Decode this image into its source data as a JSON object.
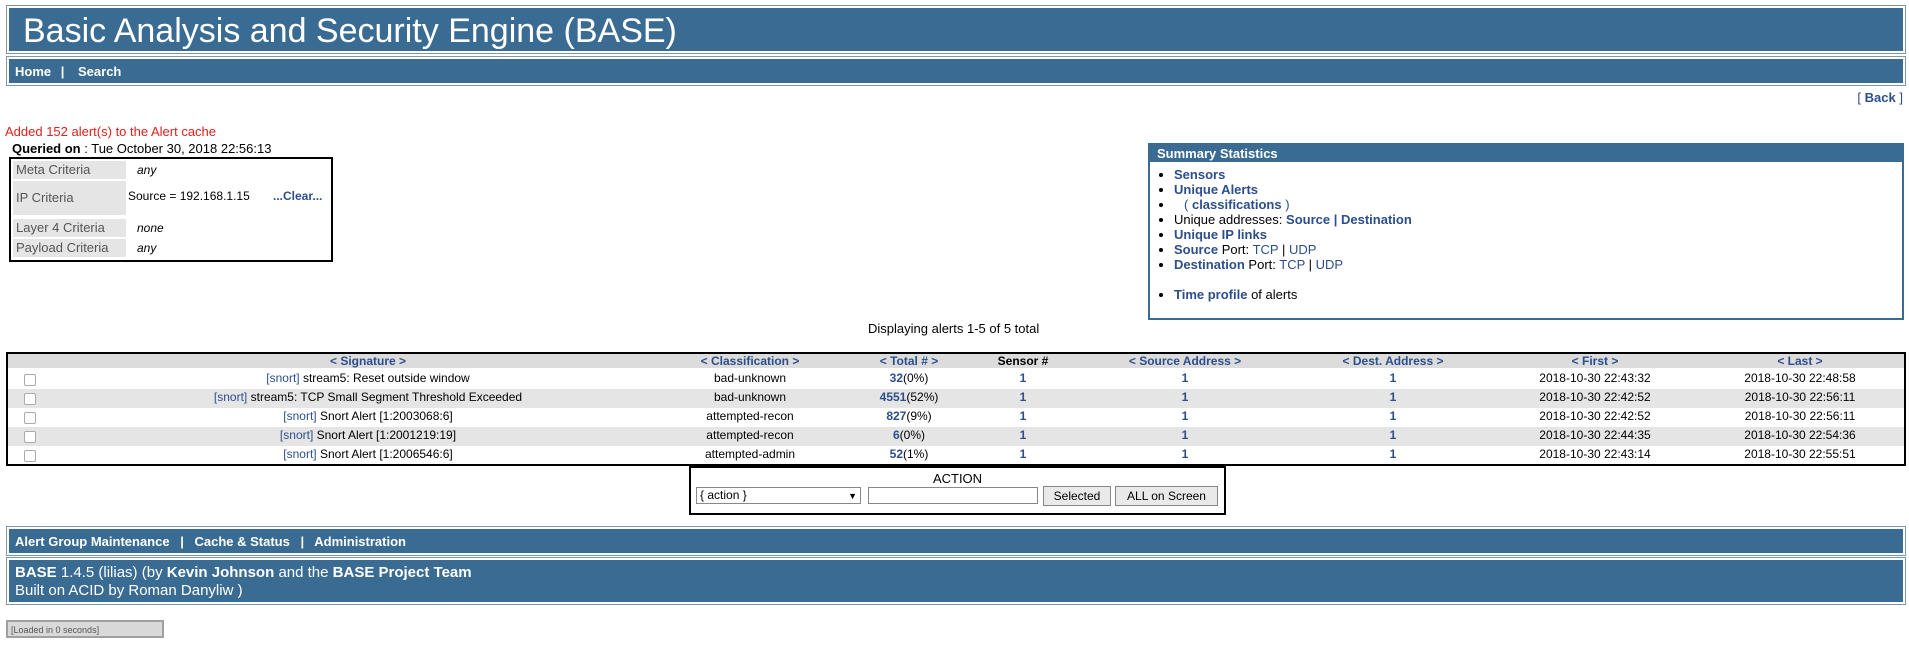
{
  "app": {
    "title": "Basic Analysis and Security Engine (BASE)"
  },
  "nav": {
    "home": "Home",
    "sep": "|",
    "search": "Search"
  },
  "back": {
    "open": "[",
    "label": "Back",
    "close": "]"
  },
  "cache_message": "Added 152 alert(s) to the Alert cache",
  "queried": {
    "label": "Queried on",
    "sep": " : ",
    "value": "Tue October 30, 2018 22:56:13"
  },
  "criteria": {
    "meta": {
      "label": "Meta Criteria",
      "value": "any"
    },
    "ip": {
      "label": "IP Criteria",
      "value": "Source = 192.168.1.15",
      "clear": "...Clear..."
    },
    "layer4": {
      "label": "Layer 4 Criteria",
      "value": "none"
    },
    "payload": {
      "label": "Payload Criteria",
      "value": "any"
    }
  },
  "summary": {
    "title": "Summary Statistics",
    "sensors": "Sensors",
    "unique_alerts": "Unique Alerts",
    "classifications": "classifications",
    "unique_addresses": "Unique addresses:",
    "source": "Source",
    "destination": "Destination",
    "unique_ip_links": "Unique IP links",
    "source_port_label": "Source",
    "port": "Port:",
    "tcp": "TCP",
    "udp": "UDP",
    "dest_port_label": "Destination",
    "time_profile": "Time profile",
    "of_alerts": "of alerts"
  },
  "displaying": "Displaying alerts 1-5 of 5 total",
  "table": {
    "headers": {
      "signature": "< Signature >",
      "classification": "< Classification >",
      "total": "< Total # >",
      "sensor": "Sensor #",
      "src": "< Source Address >",
      "dst": "< Dest. Address >",
      "first": "< First >",
      "last": "< Last >"
    },
    "rows": [
      {
        "tag": "[snort]",
        "sig": "stream5: Reset outside window",
        "cls": "bad-unknown",
        "total": "32",
        "pct": "(0%)",
        "sensor": "1",
        "src": "1",
        "dst": "1",
        "first": "2018-10-30 22:43:32",
        "last": "2018-10-30 22:48:58"
      },
      {
        "tag": "[snort]",
        "sig": "stream5: TCP Small Segment Threshold Exceeded",
        "cls": "bad-unknown",
        "total": "4551",
        "pct": "(52%)",
        "sensor": "1",
        "src": "1",
        "dst": "1",
        "first": "2018-10-30 22:42:52",
        "last": "2018-10-30 22:56:11"
      },
      {
        "tag": "[snort]",
        "sig": "Snort Alert [1:2003068:6]",
        "cls": "attempted-recon",
        "total": "827",
        "pct": "(9%)",
        "sensor": "1",
        "src": "1",
        "dst": "1",
        "first": "2018-10-30 22:42:52",
        "last": "2018-10-30 22:56:11"
      },
      {
        "tag": "[snort]",
        "sig": "Snort Alert [1:2001219:19]",
        "cls": "attempted-recon",
        "total": "6",
        "pct": "(0%)",
        "sensor": "1",
        "src": "1",
        "dst": "1",
        "first": "2018-10-30 22:44:35",
        "last": "2018-10-30 22:54:36"
      },
      {
        "tag": "[snort]",
        "sig": "Snort Alert [1:2006546:6]",
        "cls": "attempted-admin",
        "total": "52",
        "pct": "(1%)",
        "sensor": "1",
        "src": "1",
        "dst": "1",
        "first": "2018-10-30 22:43:14",
        "last": "2018-10-30 22:55:51"
      }
    ]
  },
  "action": {
    "label": "ACTION",
    "select": "{ action }",
    "selected_btn": "Selected",
    "all_btn": "ALL on Screen"
  },
  "group_bar": {
    "alert_group": "Alert Group Maintenance",
    "sep": "|",
    "cache": "Cache & Status",
    "admin": "Administration"
  },
  "footer": {
    "base": "BASE",
    "version": "1.4.5 (lilias)",
    "by": "(by",
    "author": "Kevin Johnson",
    "and": "and the",
    "team": "BASE Project Team",
    "line2": "Built on ACID by Roman Danyliw )"
  },
  "loaded": "[Loaded in 0 seconds]",
  "colors": {
    "bar": "#3a6c93",
    "link": "#2c4e8c",
    "alert_text": "#e0201b"
  }
}
